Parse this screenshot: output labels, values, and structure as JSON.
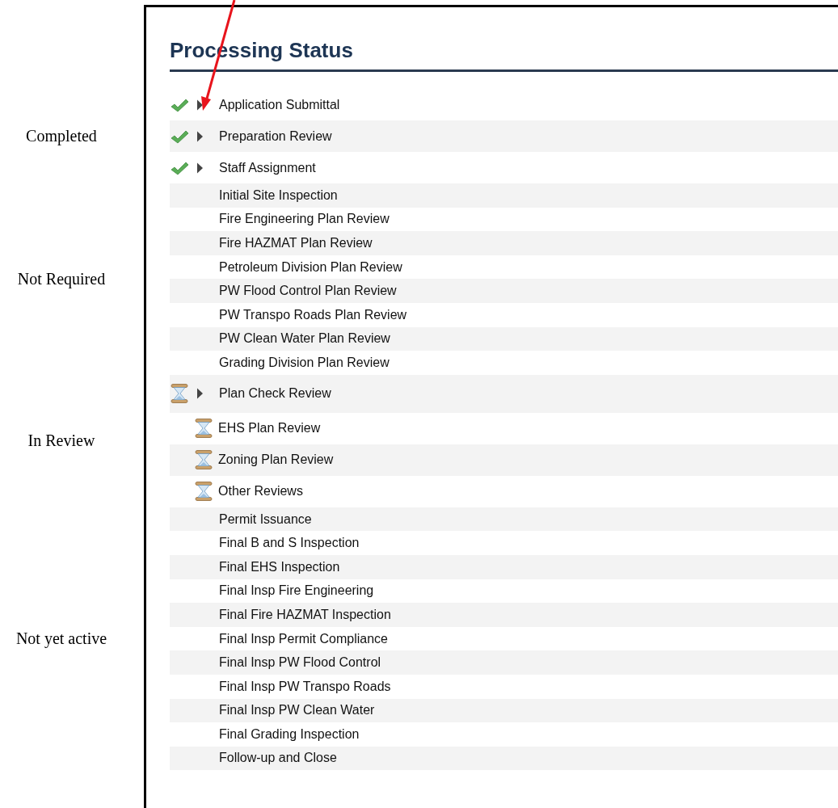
{
  "title": "Processing Status",
  "groups": [
    {
      "label": "Completed",
      "tasks": [
        {
          "name": "Application Submittal",
          "kind": "completed",
          "toggle": true
        },
        {
          "name": "Preparation Review",
          "kind": "completed",
          "toggle": true
        },
        {
          "name": "Staff Assignment",
          "kind": "completed",
          "toggle": true
        }
      ]
    },
    {
      "label": "Not Required",
      "tasks": [
        {
          "name": "Initial Site Inspection",
          "kind": "plain",
          "toggle": false
        },
        {
          "name": "Fire Engineering Plan Review",
          "kind": "plain",
          "toggle": false
        },
        {
          "name": "Fire HAZMAT Plan Review",
          "kind": "plain",
          "toggle": false
        },
        {
          "name": "Petroleum Division Plan Review",
          "kind": "plain",
          "toggle": false
        },
        {
          "name": "PW Flood Control Plan Review",
          "kind": "plain",
          "toggle": false
        },
        {
          "name": "PW Transpo Roads Plan Review",
          "kind": "plain",
          "toggle": false
        },
        {
          "name": "PW Clean Water Plan Review",
          "kind": "plain",
          "toggle": false
        },
        {
          "name": "Grading Division Plan Review",
          "kind": "plain",
          "toggle": false
        }
      ]
    },
    {
      "label": "In Review",
      "tasks": [
        {
          "name": "Plan Check Review",
          "kind": "in_review",
          "toggle": true,
          "children": [
            {
              "name": "EHS Plan Review",
              "kind": "in_review"
            },
            {
              "name": "Zoning Plan Review",
              "kind": "in_review"
            },
            {
              "name": "Other Reviews",
              "kind": "in_review"
            }
          ]
        }
      ]
    },
    {
      "label": "Not yet active",
      "tasks": [
        {
          "name": "Permit Issuance",
          "kind": "plain",
          "toggle": false
        },
        {
          "name": "Final B and S Inspection",
          "kind": "plain",
          "toggle": false
        },
        {
          "name": "Final EHS Inspection",
          "kind": "plain",
          "toggle": false
        },
        {
          "name": "Final Insp Fire Engineering",
          "kind": "plain",
          "toggle": false
        },
        {
          "name": "Final Fire HAZMAT Inspection",
          "kind": "plain",
          "toggle": false
        },
        {
          "name": "Final Insp Permit Compliance",
          "kind": "plain",
          "toggle": false
        },
        {
          "name": "Final Insp PW Flood Control",
          "kind": "plain",
          "toggle": false
        },
        {
          "name": "Final Insp PW Transpo Roads",
          "kind": "plain",
          "toggle": false
        },
        {
          "name": "Final Insp PW Clean Water",
          "kind": "plain",
          "toggle": false
        },
        {
          "name": "Final Grading Inspection",
          "kind": "plain",
          "toggle": false
        },
        {
          "name": "Follow-up and Close",
          "kind": "plain",
          "toggle": false
        }
      ]
    }
  ]
}
